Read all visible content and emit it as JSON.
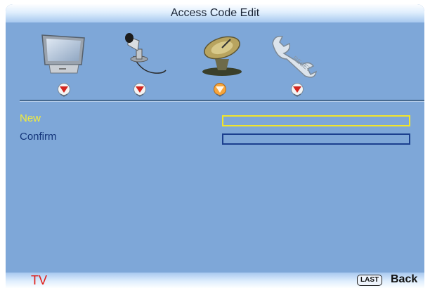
{
  "header": {
    "title": "Access Code Edit"
  },
  "menu_icons": [
    {
      "icon": "monitor-icon"
    },
    {
      "icon": "microphone-icon"
    },
    {
      "icon": "satellite-dish-icon"
    },
    {
      "icon": "wrench-icon"
    }
  ],
  "menu_arrows": {
    "selected_index": 2
  },
  "form": {
    "new_label": "New",
    "confirm_label": "Confirm",
    "new_value": "",
    "confirm_value": ""
  },
  "footer": {
    "source": "TV",
    "last_key": "LAST",
    "back_label": "Back"
  },
  "colors": {
    "background": "#7ea7d8",
    "highlight": "#f2ec3c",
    "label": "#14357a",
    "source_text": "#e01b16"
  }
}
